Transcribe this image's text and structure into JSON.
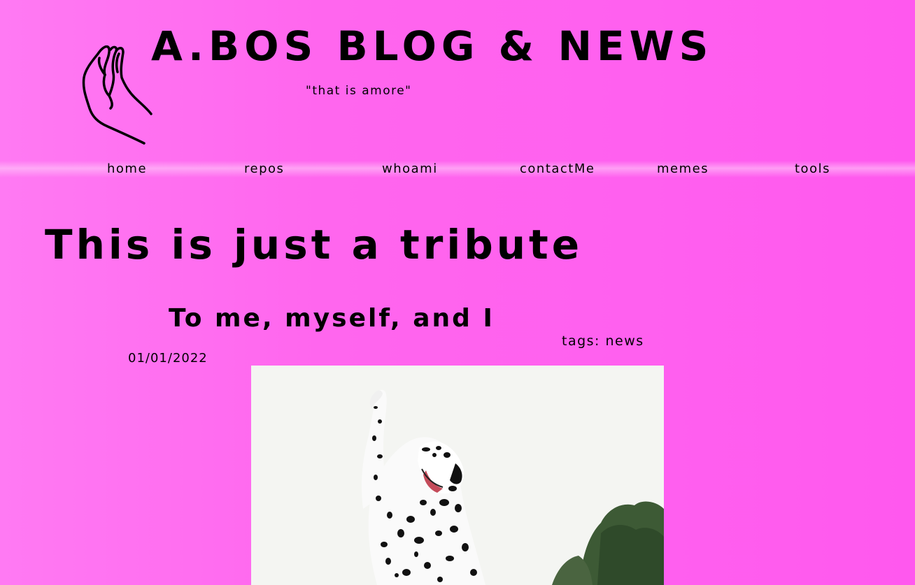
{
  "site": {
    "title": "A.BOS BLOG & NEWS",
    "tagline": "\"that is amore\"",
    "logo_icon": "italian-hand-gesture-icon"
  },
  "nav": {
    "items": [
      {
        "label": "home"
      },
      {
        "label": "repos"
      },
      {
        "label": "whoami"
      },
      {
        "label": "contactMe"
      },
      {
        "label": "memes"
      },
      {
        "label": "tools"
      }
    ]
  },
  "post": {
    "title": "This is just a tribute",
    "subtitle": "To me, myself, and I",
    "tags": "tags: news",
    "date": "01/01/2022",
    "image_subject": "dalmatian-raising-paw"
  },
  "colors": {
    "background": "#ff66ee",
    "text": "#000000"
  }
}
